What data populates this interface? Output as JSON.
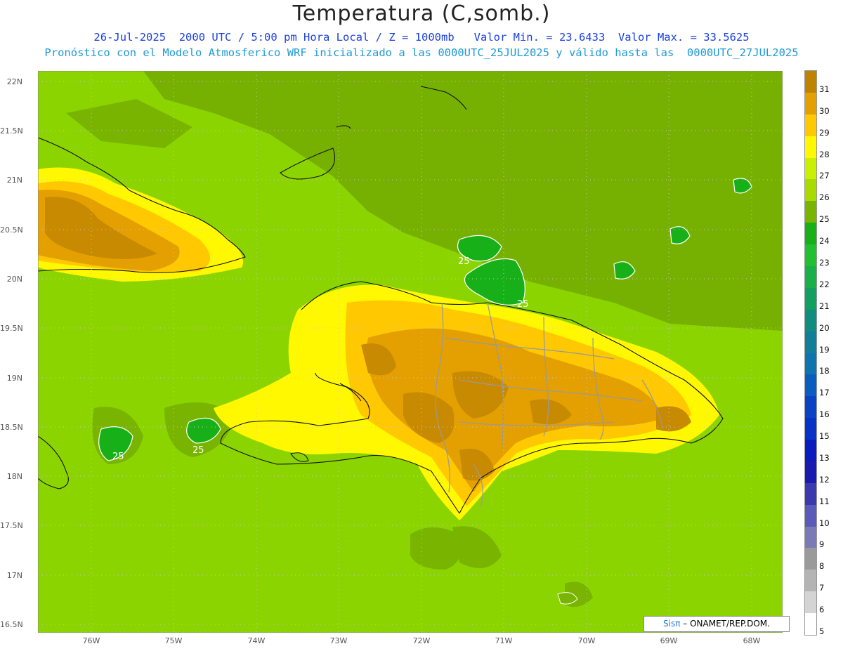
{
  "header": {
    "title": "Temperatura (C,somb.)",
    "line1": "26-Jul-2025  2000 UTC / 5:00 pm Hora Local / Z = 1000mb   Valor Min. = 23.6433  Valor Max. = 33.5625",
    "line2": "Pronóstico con el Modelo Atmosferico WRF inicializado a las 0000UTC_25JUL2025 y válido hasta las  0000UTC_27JUL2025"
  },
  "axes": {
    "lat_labels": [
      "22N",
      "21.5N",
      "21N",
      "20.5N",
      "20N",
      "19.5N",
      "19N",
      "18.5N",
      "18N",
      "17.5N",
      "17N",
      "16.5N"
    ],
    "lon_labels": [
      "76W",
      "75W",
      "74W",
      "73W",
      "72W",
      "71W",
      "70W",
      "69W",
      "68W"
    ]
  },
  "contour_labels": [
    "25",
    "25",
    "25",
    "25"
  ],
  "colorbar": {
    "labels": [
      "31",
      "30",
      "29",
      "28",
      "27",
      "26",
      "25",
      "24",
      "23",
      "22",
      "21",
      "20",
      "19",
      "18",
      "17",
      "16",
      "15",
      "13",
      "12",
      "11",
      "10",
      "9",
      "8",
      "7",
      "6",
      "5"
    ],
    "colors": [
      "#c08300",
      "#e3a000",
      "#ffc800",
      "#fff800",
      "#c8f000",
      "#a8dc00",
      "#78b400",
      "#18b018",
      "#20c030",
      "#18b048",
      "#10a060",
      "#108c80",
      "#10809a",
      "#0e74ae",
      "#0a5cc0",
      "#0a42c6",
      "#0632c8",
      "#0a1cc0",
      "#1a1ab0",
      "#3a3aae",
      "#5a5ab8",
      "#7a7ab6",
      "#9a9a9a",
      "#b4b4b4",
      "#d4d4d4",
      "#ffffff"
    ]
  },
  "credit": {
    "logo": "Sisπ",
    "text": " – ONAMET/REP.DOM."
  },
  "colors": {
    "ocean": "#76b000",
    "sea_light": "#8cd400",
    "hot": "#c88a00",
    "warm": "#ffc800"
  }
}
